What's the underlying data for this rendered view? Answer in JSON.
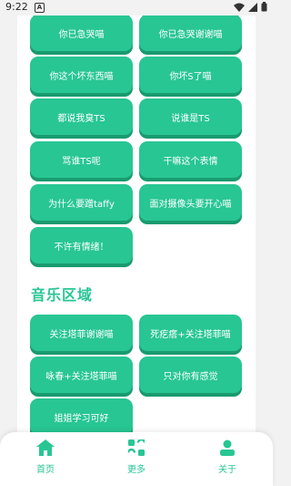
{
  "status_bar": {
    "time": "9:22",
    "notification_glyph": "A"
  },
  "buttons": [
    {
      "label": "你已急哭喵"
    },
    {
      "label": "你已急哭谢谢喵"
    },
    {
      "label": "你这个坏东西喵"
    },
    {
      "label": "你坏S了喵"
    },
    {
      "label": "都说我臭TS"
    },
    {
      "label": "说谁是TS"
    },
    {
      "label": "骂谁TS呢"
    },
    {
      "label": "干嘛这个表情"
    },
    {
      "label": "为什么要蹭taffy"
    },
    {
      "label": "面对摄像头要开心喵"
    },
    {
      "label": "不许有情绪！"
    }
  ],
  "music_section": {
    "title": "音乐区域",
    "buttons": [
      {
        "label": "关注塔菲谢谢喵"
      },
      {
        "label": "死疙瘩+关注塔菲喵"
      },
      {
        "label": "咏春+关注塔菲喵"
      },
      {
        "label": "只对你有感觉"
      },
      {
        "label": "姐姐学习可好"
      }
    ]
  },
  "bottom_nav": {
    "items": [
      {
        "label": "首页",
        "icon": "home-icon"
      },
      {
        "label": "更多",
        "icon": "more-icon"
      },
      {
        "label": "关于",
        "icon": "about-icon"
      }
    ]
  },
  "colors": {
    "accent": "#27c692",
    "accent_shadow": "#1a9a6f",
    "page_bg": "#f2f2f2"
  }
}
